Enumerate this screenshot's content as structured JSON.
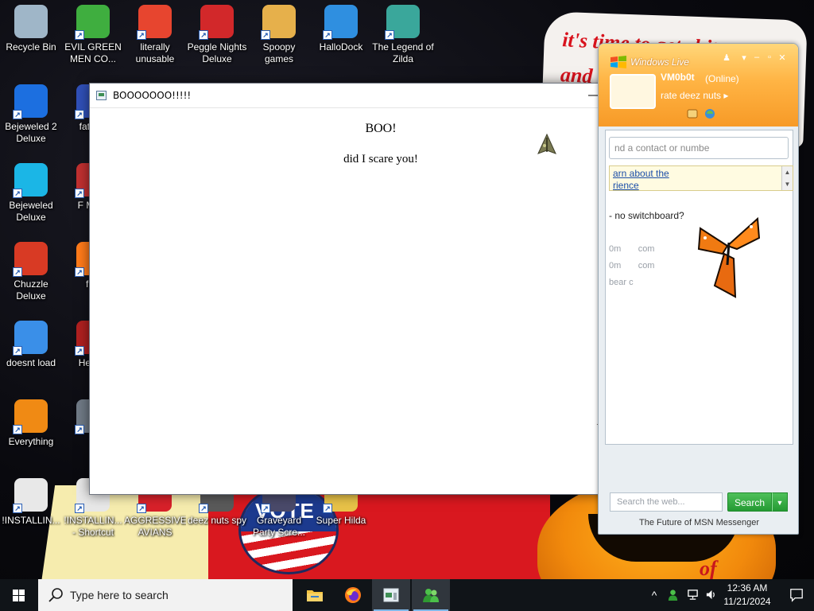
{
  "wallpaper": {
    "paper_text_line1": "it's time to get shit",
    "paper_text_line2": "and",
    "badge_text": "VOTE",
    "blot_text": "of"
  },
  "desktop_icons": [
    {
      "id": "recycle-bin",
      "label": "Recycle Bin",
      "color": "#9fb6c8"
    },
    {
      "id": "evil-green-men",
      "label": "EVIL GREEN MEN CO...",
      "color": "#3fae3f"
    },
    {
      "id": "literally-unusable",
      "label": "literally unusable",
      "color": "#e7452f"
    },
    {
      "id": "peggle-nights",
      "label": "Peggle Nights Deluxe",
      "color": "#d2282a"
    },
    {
      "id": "spoopy-games",
      "label": "Spoopy games",
      "color": "#e6b04b"
    },
    {
      "id": "hallodock",
      "label": "HalloDock",
      "color": "#2f8fe0"
    },
    {
      "id": "legend-of-zilda",
      "label": "The Legend of Zilda",
      "color": "#3aa79b"
    },
    {
      "id": "bejeweled-2",
      "label": "Bejeweled 2 Deluxe",
      "color": "#1c6fe0"
    },
    {
      "id": "fat-like",
      "label": "fat like",
      "color": "#3050b8"
    },
    {
      "id": "bejeweled-deluxe",
      "label": "Bejeweled Deluxe",
      "color": "#1bb6e6"
    },
    {
      "id": "f-mon",
      "label": "F MON",
      "color": "#c03030"
    },
    {
      "id": "chuzzle-deluxe",
      "label": "Chuzzle Deluxe",
      "color": "#d83a24"
    },
    {
      "id": "furr",
      "label": "furr",
      "color": "#ff7b1a"
    },
    {
      "id": "doesnt-load",
      "label": "doesnt load",
      "color": "#3a8fe8"
    },
    {
      "id": "he-we",
      "label": "He We",
      "color": "#b02020"
    },
    {
      "id": "everything",
      "label": "Everything",
      "color": "#f08a14"
    },
    {
      "id": "is",
      "label": "is",
      "color": "#707a86"
    },
    {
      "id": "installing-1",
      "label": "!INSTALLIN...",
      "color": "#e8e8e8"
    },
    {
      "id": "installing-shortcut",
      "label": "!INSTALLIN... - Shortcut",
      "color": "#e8e8e8"
    },
    {
      "id": "aggressive-avians",
      "label": "AGGRESSIVE AVIANS",
      "color": "#d8212a"
    },
    {
      "id": "deez-nuts-spy",
      "label": "deez nuts spy",
      "color": "#5a5a5a"
    },
    {
      "id": "graveyard-party",
      "label": "Graveyard Party Scre...",
      "color": "#4a4a6a"
    },
    {
      "id": "super-hilda",
      "label": "Super Hilda",
      "color": "#e8c248"
    }
  ],
  "boo_window": {
    "title": "BOOOOOOO!!!!!",
    "minimize": "—",
    "maximize": "☐",
    "close": "✕",
    "heading": "BOO!",
    "subtext": "did I scare you!"
  },
  "msn": {
    "brand": "Windows Live",
    "name": "VM0b0t",
    "status": "(Online)",
    "personal_message": "rate deez nuts",
    "search_contacts_placeholder": "nd a contact or numbe",
    "learn_line1": "arn about the",
    "learn_line2": "rience",
    "list_line1": "- no switchboard?",
    "list_line2": "0m",
    "list_line2b": "com",
    "list_line3": "0m",
    "list_line3b": "com",
    "list_line4": "bear c",
    "web_search_placeholder": "Search the web...",
    "search_button": "Search",
    "footer": "The Future of MSN Messenger",
    "accent_color": "#f79a27"
  },
  "taskbar": {
    "search_placeholder": "Type here to search",
    "time": "12:36 AM",
    "date": "11/21/2024",
    "tray_chevron": "^"
  }
}
